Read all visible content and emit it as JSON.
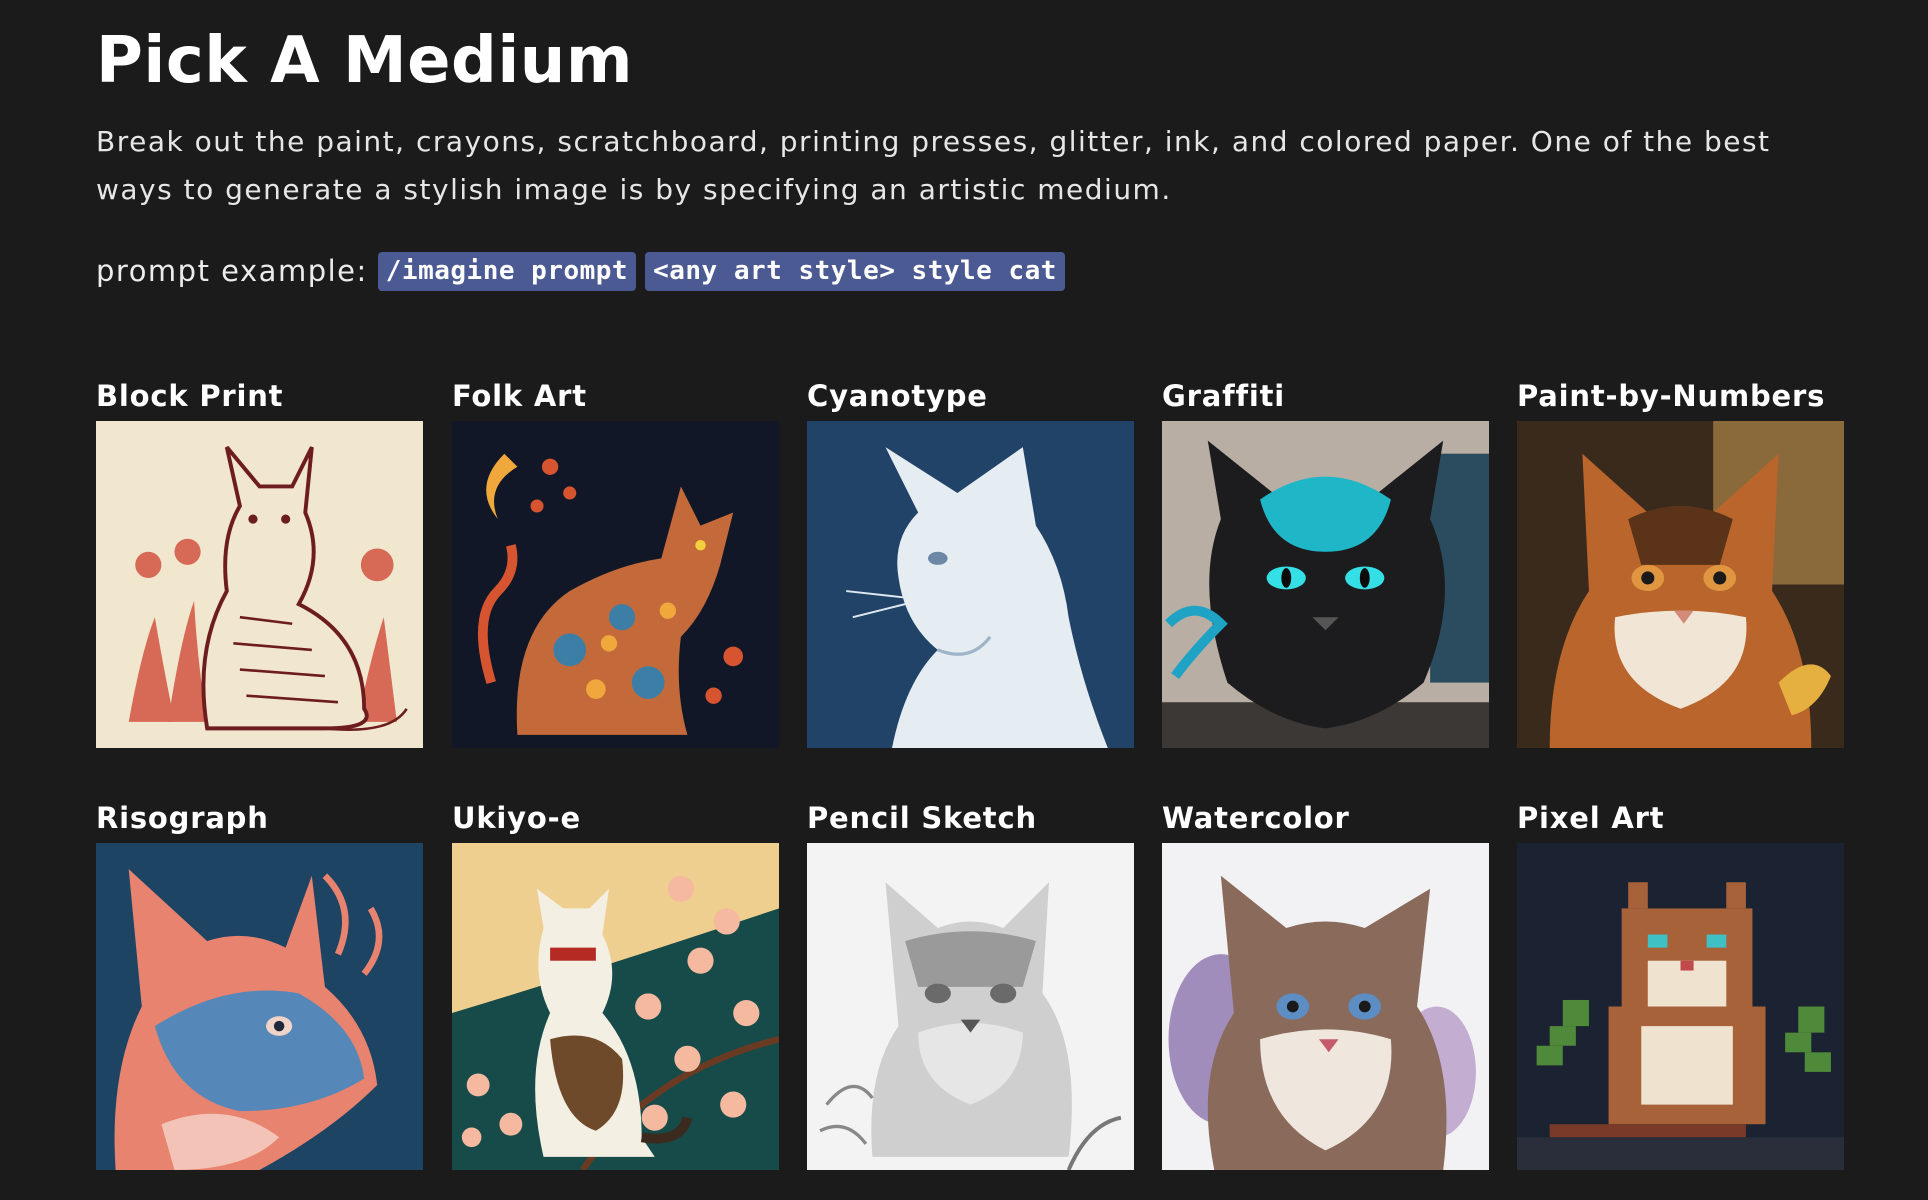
{
  "header": {
    "title": "Pick A Medium",
    "intro": "Break out the paint, crayons, scratchboard, printing presses, glitter, ink, and colored paper. One of the best ways to generate a stylish image is by specifying an artistic medium.",
    "prompt_label": "prompt example:",
    "prompt_command": "/imagine prompt",
    "prompt_text": "<any art style> style cat"
  },
  "colors": {
    "background": "#1b1b1b",
    "code_background": "#4c5a93",
    "text": "#ffffff"
  },
  "gallery": [
    {
      "label": "Block Print",
      "icon": "block-print-cat-image"
    },
    {
      "label": "Folk Art",
      "icon": "folk-art-cat-image"
    },
    {
      "label": "Cyanotype",
      "icon": "cyanotype-cat-image"
    },
    {
      "label": "Graffiti",
      "icon": "graffiti-cat-image"
    },
    {
      "label": "Paint-by-Numbers",
      "icon": "paint-by-numbers-cat-image"
    },
    {
      "label": "Risograph",
      "icon": "risograph-cat-image"
    },
    {
      "label": "Ukiyo-e",
      "icon": "ukiyo-e-cat-image"
    },
    {
      "label": "Pencil Sketch",
      "icon": "pencil-sketch-cat-image"
    },
    {
      "label": "Watercolor",
      "icon": "watercolor-cat-image"
    },
    {
      "label": "Pixel Art",
      "icon": "pixel-art-cat-image"
    }
  ]
}
